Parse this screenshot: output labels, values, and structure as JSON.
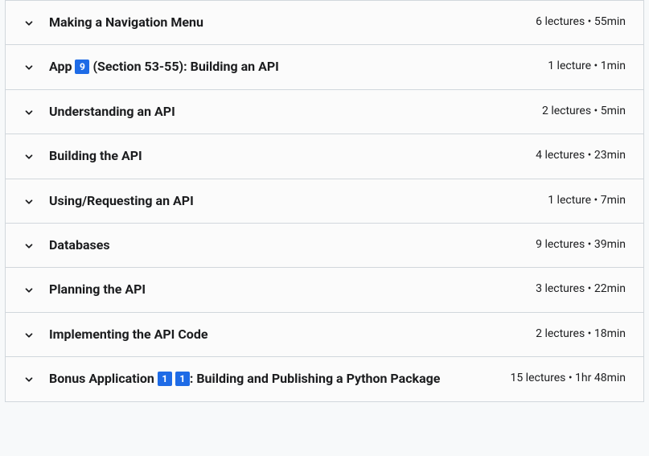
{
  "sections": [
    {
      "title_parts": [
        "Making a Navigation Menu"
      ],
      "meta": "6 lectures • 55min"
    },
    {
      "title_parts": [
        "App ",
        {
          "badge": "9"
        },
        " (Section 53-55): Building an API"
      ],
      "meta": "1 lecture • 1min"
    },
    {
      "title_parts": [
        "Understanding an API"
      ],
      "meta": "2 lectures • 5min"
    },
    {
      "title_parts": [
        "Building the API"
      ],
      "meta": "4 lectures • 23min"
    },
    {
      "title_parts": [
        "Using/Requesting an API"
      ],
      "meta": "1 lecture • 7min"
    },
    {
      "title_parts": [
        "Databases"
      ],
      "meta": "9 lectures • 39min"
    },
    {
      "title_parts": [
        "Planning the API"
      ],
      "meta": "3 lectures • 22min"
    },
    {
      "title_parts": [
        "Implementing the API Code"
      ],
      "meta": "2 lectures • 18min"
    },
    {
      "title_parts": [
        "Bonus Application ",
        {
          "badge": "1"
        },
        " ",
        {
          "badge": "1"
        },
        ": Building and Publishing a Python Package"
      ],
      "meta": "15 lectures • 1hr 48min"
    }
  ]
}
